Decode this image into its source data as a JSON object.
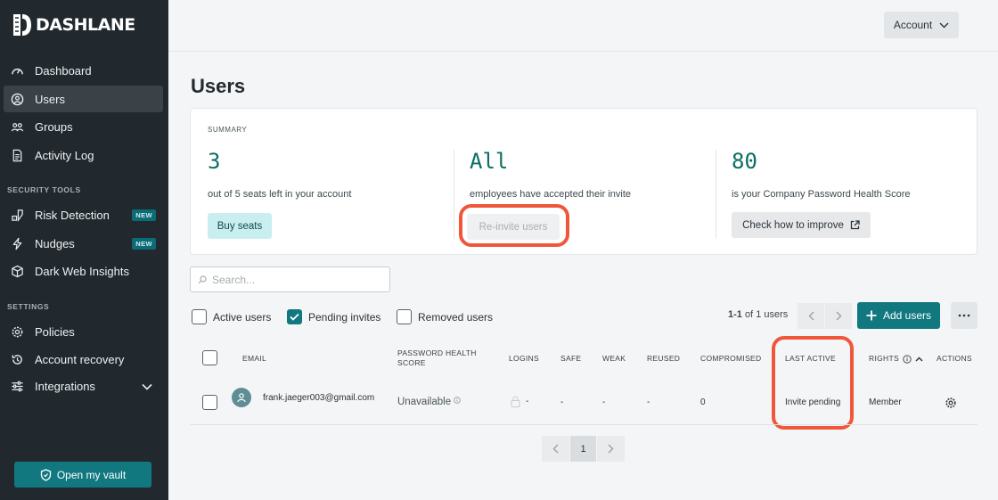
{
  "brand": {
    "name": "DASHLANE"
  },
  "sidebar": {
    "items": [
      {
        "label": "Dashboard",
        "icon": "gauge-icon"
      },
      {
        "label": "Users",
        "icon": "user-circle-icon",
        "active": true
      },
      {
        "label": "Groups",
        "icon": "group-icon"
      },
      {
        "label": "Activity Log",
        "icon": "document-icon"
      }
    ],
    "security_label": "SECURITY TOOLS",
    "security_items": [
      {
        "label": "Risk Detection",
        "badge": "NEW"
      },
      {
        "label": "Nudges",
        "badge": "NEW"
      },
      {
        "label": "Dark Web Insights"
      }
    ],
    "settings_label": "SETTINGS",
    "settings_items": [
      {
        "label": "Policies"
      },
      {
        "label": "Account recovery"
      },
      {
        "label": "Integrations"
      }
    ],
    "vault_button": "Open my vault"
  },
  "header": {
    "account_label": "Account"
  },
  "page": {
    "title": "Users"
  },
  "summary": {
    "label": "SUMMARY",
    "seats": {
      "value": "3",
      "caption": "out of 5 seats left in your account",
      "button": "Buy seats"
    },
    "invites": {
      "value": "All",
      "caption": "employees have accepted their invite",
      "button": "Re-invite users"
    },
    "health": {
      "value": "80",
      "caption": "is your Company Password Health Score",
      "button": "Check how to improve"
    }
  },
  "search": {
    "placeholder": "Search..."
  },
  "filters": {
    "active": "Active users",
    "pending": "Pending invites",
    "removed": "Removed users"
  },
  "pagination": {
    "range": "1-1",
    "of_text": "of 1 users",
    "current_page": "1"
  },
  "actions": {
    "add_users": "Add users"
  },
  "table": {
    "headers": {
      "email": "EMAIL",
      "health1": "PASSWORD HEALTH",
      "health2": "SCORE",
      "logins": "LOGINS",
      "safe": "SAFE",
      "weak": "WEAK",
      "reused": "REUSED",
      "compromised": "COMPROMISED",
      "last_active": "LAST ACTIVE",
      "rights": "RIGHTS",
      "actions": "ACTIONS"
    },
    "rows": [
      {
        "email": "frank.jaeger003@gmail.com",
        "health": "Unavailable",
        "logins": "-",
        "safe": "-",
        "weak": "-",
        "reused": "-",
        "compromised": "0",
        "last_active": "Invite pending",
        "rights": "Member"
      }
    ]
  },
  "colors": {
    "accent": "#117880",
    "highlight": "#f0573a",
    "sidebar": "#22292e"
  }
}
